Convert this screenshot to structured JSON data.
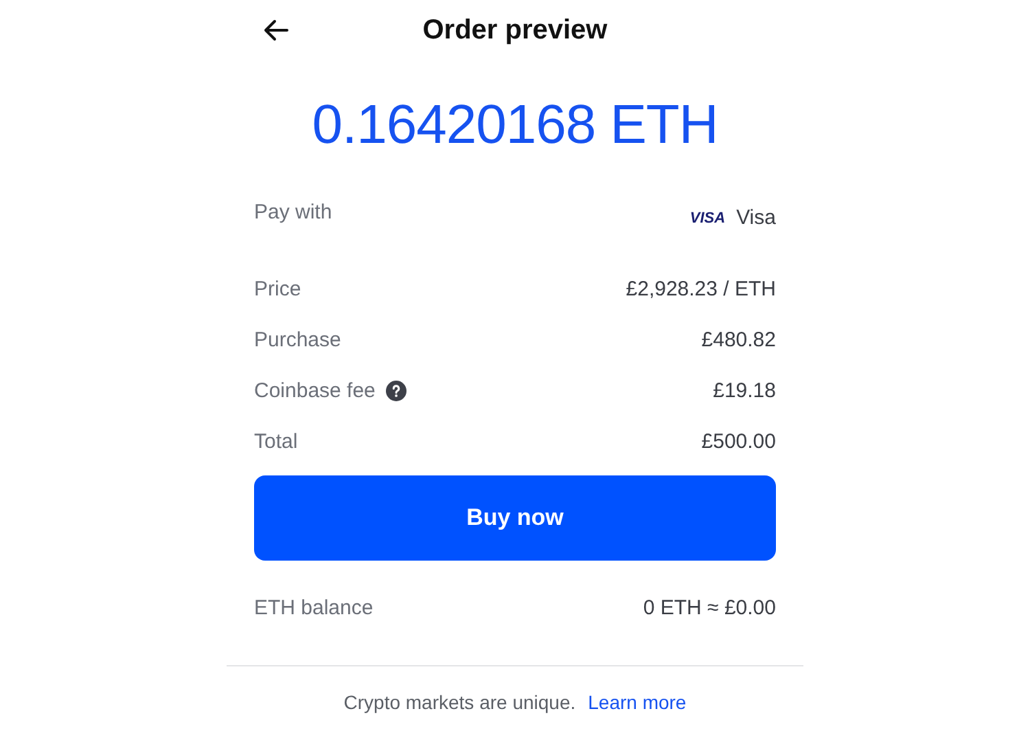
{
  "header": {
    "title": "Order preview"
  },
  "amount": "0.16420168 ETH",
  "details": [
    {
      "kind": "card",
      "label": "Pay with",
      "card_logo": "VISA",
      "value": "Visa"
    },
    {
      "kind": "plain",
      "label": "Price",
      "value": "£2,928.23 / ETH"
    },
    {
      "kind": "plain",
      "label": "Purchase",
      "value": "£480.82"
    },
    {
      "kind": "info",
      "label": "Coinbase fee",
      "value": "£19.18"
    },
    {
      "kind": "plain",
      "label": "Total",
      "value": "£500.00"
    }
  ],
  "primary_button": "Buy now",
  "balance": {
    "label": "ETH balance",
    "value": "0 ETH ≈ £0.00"
  },
  "footer": {
    "text": "Crypto markets are unique.",
    "link": "Learn more"
  }
}
